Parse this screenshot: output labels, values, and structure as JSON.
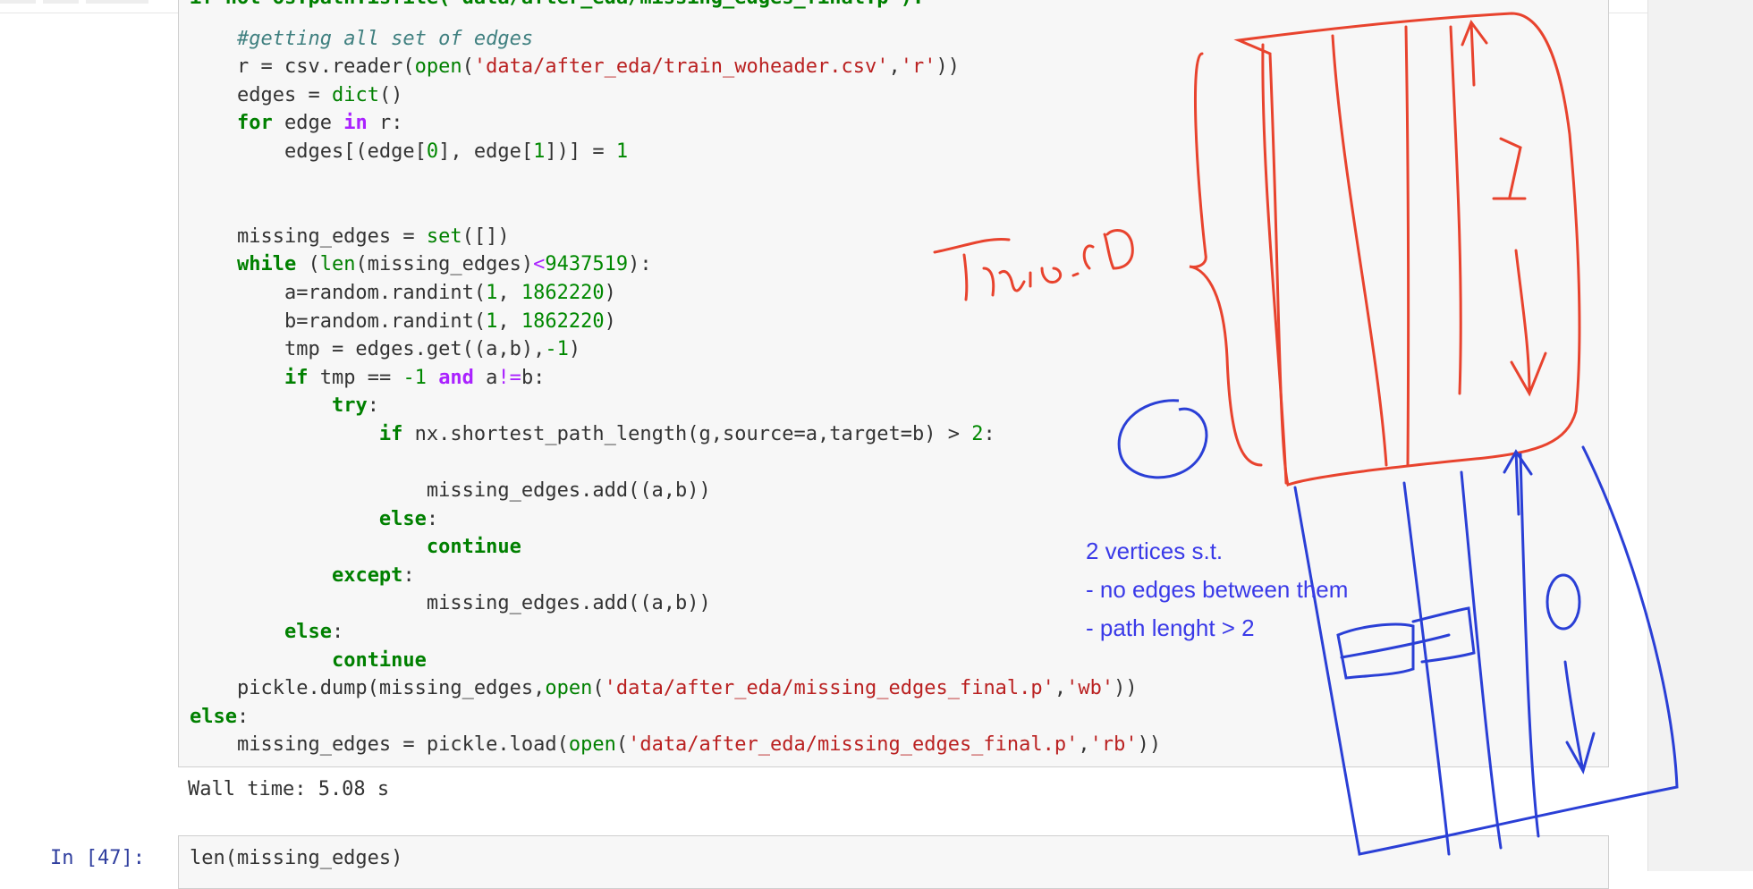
{
  "code_lines": [
    [
      {
        "t": "if not os.path.isfile('data/after_eda/missing_edges_final.p'):",
        "c": "cut"
      }
    ],
    [
      {
        "t": "    "
      },
      {
        "t": "#getting all set of edges",
        "c": "cm"
      }
    ],
    [
      {
        "t": "    r = csv.reader("
      },
      {
        "t": "open",
        "c": "bi"
      },
      {
        "t": "("
      },
      {
        "t": "'data/after_eda/train_woheader.csv'",
        "c": "st"
      },
      {
        "t": ","
      },
      {
        "t": "'r'",
        "c": "st"
      },
      {
        "t": "))"
      }
    ],
    [
      {
        "t": "    edges = "
      },
      {
        "t": "dict",
        "c": "bi"
      },
      {
        "t": "()"
      }
    ],
    [
      {
        "t": "    "
      },
      {
        "t": "for",
        "c": "kw"
      },
      {
        "t": " edge "
      },
      {
        "t": "in",
        "c": "kwop"
      },
      {
        "t": " r:"
      }
    ],
    [
      {
        "t": "        edges[(edge["
      },
      {
        "t": "0",
        "c": "nm"
      },
      {
        "t": "], edge["
      },
      {
        "t": "1",
        "c": "nm"
      },
      {
        "t": "])] = "
      },
      {
        "t": "1",
        "c": "nm"
      }
    ],
    [
      {
        "t": ""
      }
    ],
    [
      {
        "t": ""
      }
    ],
    [
      {
        "t": "    missing_edges = "
      },
      {
        "t": "set",
        "c": "bi"
      },
      {
        "t": "([])"
      }
    ],
    [
      {
        "t": "    "
      },
      {
        "t": "while",
        "c": "kw"
      },
      {
        "t": " ("
      },
      {
        "t": "len",
        "c": "bi"
      },
      {
        "t": "(missing_edges)"
      },
      {
        "t": "<",
        "c": "op"
      },
      {
        "t": "9437519",
        "c": "nm"
      },
      {
        "t": "):"
      }
    ],
    [
      {
        "t": "        a=random.randint("
      },
      {
        "t": "1",
        "c": "nm"
      },
      {
        "t": ", "
      },
      {
        "t": "1862220",
        "c": "nm"
      },
      {
        "t": ")"
      }
    ],
    [
      {
        "t": "        b=random.randint("
      },
      {
        "t": "1",
        "c": "nm"
      },
      {
        "t": ", "
      },
      {
        "t": "1862220",
        "c": "nm"
      },
      {
        "t": ")"
      }
    ],
    [
      {
        "t": "        tmp = edges.get((a,b),"
      },
      {
        "t": "-1",
        "c": "nm"
      },
      {
        "t": ")"
      }
    ],
    [
      {
        "t": "        "
      },
      {
        "t": "if",
        "c": "kw"
      },
      {
        "t": " tmp == "
      },
      {
        "t": "-1",
        "c": "nm"
      },
      {
        "t": " "
      },
      {
        "t": "and",
        "c": "kwop"
      },
      {
        "t": " a"
      },
      {
        "t": "!=",
        "c": "op"
      },
      {
        "t": "b:"
      }
    ],
    [
      {
        "t": "            "
      },
      {
        "t": "try",
        "c": "kw"
      },
      {
        "t": ":"
      }
    ],
    [
      {
        "t": "                "
      },
      {
        "t": "if",
        "c": "kw"
      },
      {
        "t": " nx.shortest_path_length(g,source=a,target=b) > "
      },
      {
        "t": "2",
        "c": "nm"
      },
      {
        "t": ":"
      }
    ],
    [
      {
        "t": ""
      }
    ],
    [
      {
        "t": "                    missing_edges.add((a,b))"
      }
    ],
    [
      {
        "t": "                "
      },
      {
        "t": "else",
        "c": "kw"
      },
      {
        "t": ":"
      }
    ],
    [
      {
        "t": "                    "
      },
      {
        "t": "continue",
        "c": "kw"
      }
    ],
    [
      {
        "t": "            "
      },
      {
        "t": "except",
        "c": "kw"
      },
      {
        "t": ":"
      }
    ],
    [
      {
        "t": "                    missing_edges.add((a,b))"
      }
    ],
    [
      {
        "t": "        "
      },
      {
        "t": "else",
        "c": "kw"
      },
      {
        "t": ":"
      }
    ],
    [
      {
        "t": "            "
      },
      {
        "t": "continue",
        "c": "kw"
      }
    ],
    [
      {
        "t": "    pickle.dump(missing_edges,"
      },
      {
        "t": "open",
        "c": "bi"
      },
      {
        "t": "("
      },
      {
        "t": "'data/after_eda/missing_edges_final.p'",
        "c": "st"
      },
      {
        "t": ","
      },
      {
        "t": "'wb'",
        "c": "st"
      },
      {
        "t": "))"
      }
    ],
    [
      {
        "t": "else",
        "c": "kw"
      },
      {
        "t": ":"
      }
    ],
    [
      {
        "t": "    missing_edges = pickle.load("
      },
      {
        "t": "open",
        "c": "bi"
      },
      {
        "t": "("
      },
      {
        "t": "'data/after_eda/missing_edges_final.p'",
        "c": "st"
      },
      {
        "t": ","
      },
      {
        "t": "'rb'",
        "c": "st"
      },
      {
        "t": "))"
      }
    ]
  ],
  "output": {
    "wall_time": "Wall time: 5.08 s"
  },
  "next_cell": {
    "prompt": "In [47]:",
    "code": "len(missing_edges)"
  },
  "annotations": {
    "handwritten_label": "Train.csv",
    "label_one": "1",
    "label_zero": "0",
    "note_lines": [
      "2 vertices s.t.",
      "- no edges between them",
      "- path lenght > 2"
    ]
  },
  "colors": {
    "ink_red": "#e8432e",
    "ink_blue": "#2a3fd6",
    "note_text": "#3a3ae8"
  }
}
